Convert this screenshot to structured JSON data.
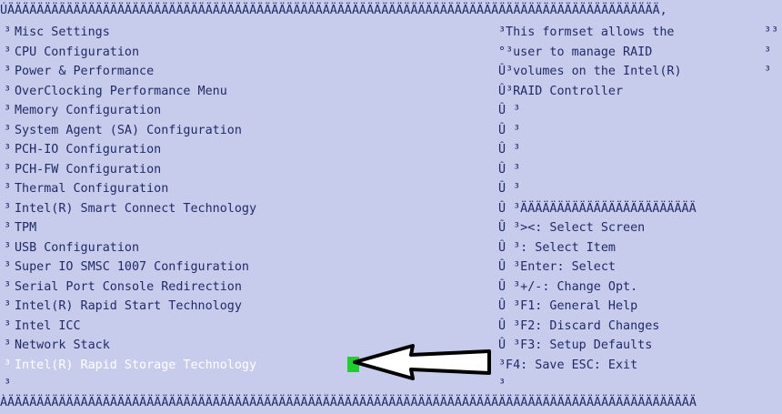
{
  "top_border": "ÚÄÄÄÄÄÄÄÄÄÄÄÄÄÄÄÄÄÄÄÄÄÄÄÄÄÄÄÄÄÄÄÄÄÄÄÄÄÄÄÄÄÄÄÄÄÄÄÄÄÄÄÄÄÄÄÄÄÄÄÄÄÄÄÄÄÄÄÄÄÄÄÄÄÄÄÄÄÄÄÄÄÄÄÄÄÄÄÄÄ,",
  "bottom_border": "ÀÄÄÄÄÄÄÄÄÄÄÄÄÄÄÄÄÄÄÄÄÄÄÄÄÄÄÄÄÄÄÄÄÄÄÄÄÄÄÄÄÄÄÄÄÄÄÄÄÄÄÄÄÄÄÄÄÄÄÄÄÄÄÄÄÄÄÄÄÄÄÄÄÄÄÄÄÄÄÄÄÄÄÄÄÄÄÄÄÄÄÄÄÄÄ",
  "menu_mark": "³",
  "menu_items": [
    "Misc Settings",
    "CPU Configuration",
    "Power & Performance",
    "OverClocking Performance Menu",
    "Memory Configuration",
    "System Agent (SA) Configuration",
    "PCH-IO Configuration",
    "PCH-FW Configuration",
    "Thermal Configuration",
    "Intel(R) Smart Connect Technology",
    "TPM",
    "USB Configuration",
    "Super IO SMSC 1007 Configuration",
    "Serial Port Console Redirection",
    "Intel(R) Rapid Start Technology",
    "Intel ICC",
    "Network Stack",
    "Intel(R) Rapid Storage Technology"
  ],
  "help_lines": [
    "³This formset allows the",
    "°³user to manage RAID",
    "Û³volumes on the Intel(R)",
    "Û³RAID Controller",
    "Û ³",
    "Û ³",
    "Û ³",
    "Û ³",
    "Û ³",
    "Û ³ÄÄÄÄÄÄÄÄÄÄÄÄÄÄÄÄÄÄÄÄÄÄÄÄ",
    "Û ³><: Select Screen",
    "Û ³: Select Item",
    "Û ³Enter: Select",
    "Û ³+/-: Change Opt.",
    "Û ³F1: General Help",
    "Û ³F2: Discard Changes",
    "Û ³F3: Setup Defaults",
    "  ³F4: Save  ESC: Exit",
    "  ³"
  ],
  "right_edge_marks": [
    "³³",
    "³",
    "³",
    "",
    "",
    "",
    "",
    "",
    "",
    "",
    "",
    "",
    "",
    "",
    "",
    "",
    "",
    "",
    ""
  ],
  "colors": {
    "background": "#c8ccec",
    "text": "#1f2b66",
    "selected_text": "#ffffff",
    "cursor": "#1fcf2a"
  },
  "selected_index": 17
}
